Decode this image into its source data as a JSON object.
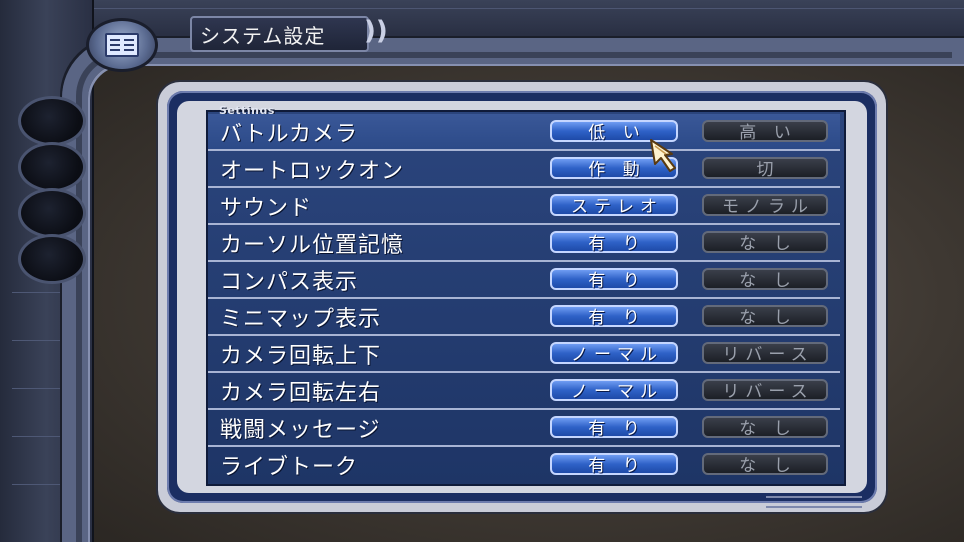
{
  "header": {
    "title": "システム設定",
    "bracket": "))",
    "icon": "menu-list-icon"
  },
  "panel": {
    "heading": "Settings"
  },
  "settings": [
    {
      "label": "バトルカメラ",
      "on": "低 い",
      "off": "高 い"
    },
    {
      "label": "オートロックオン",
      "on": "作 動",
      "off": "切"
    },
    {
      "label": "サウンド",
      "on": "ステレオ",
      "off": "モノラル"
    },
    {
      "label": "カーソル位置記憶",
      "on": "有 り",
      "off": "な し"
    },
    {
      "label": "コンパス表示",
      "on": "有 り",
      "off": "な し"
    },
    {
      "label": "ミニマップ表示",
      "on": "有 り",
      "off": "な し"
    },
    {
      "label": "カメラ回転上下",
      "on": "ノーマル",
      "off": "リバース"
    },
    {
      "label": "カメラ回転左右",
      "on": "ノーマル",
      "off": "リバース"
    },
    {
      "label": "戦闘メッセージ",
      "on": "有 り",
      "off": "な し"
    },
    {
      "label": "ライブトーク",
      "on": "有 り",
      "off": "な し"
    }
  ],
  "selected_row": 0,
  "cursor_icon": "hand-pointer-icon",
  "colors": {
    "active_option": "#2f62c8",
    "inactive_option": "#1c1f26",
    "list_background": "#2b457d"
  }
}
